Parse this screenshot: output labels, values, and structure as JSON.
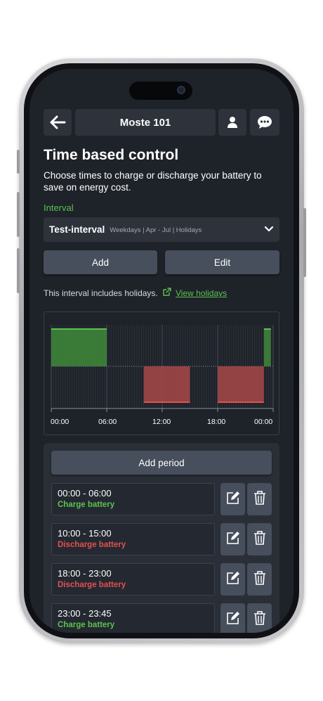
{
  "header": {
    "back_icon": "arrow-left-icon",
    "site_name": "Moste 101",
    "user_icon": "user-icon",
    "chat_icon": "chat-bubble-icon"
  },
  "page": {
    "title": "Time based control",
    "subtitle": "Choose times to charge or discharge your battery to save on energy cost."
  },
  "interval": {
    "label": "Interval",
    "selected_name": "Test-interval",
    "selected_desc": "Weekdays | Apr - Jul | Holidays",
    "add_label": "Add",
    "edit_label": "Edit",
    "holiday_text": "This interval includes holidays.",
    "holiday_link": "View holidays"
  },
  "colors": {
    "charge": "#5cc24f",
    "discharge": "#e05151",
    "background": "#1e2229",
    "button": "#474e5c"
  },
  "chart_data": {
    "type": "bar",
    "x_unit": "hours",
    "xlim": [
      0,
      24
    ],
    "x_ticks": [
      "00:00",
      "06:00",
      "12:00",
      "18:00",
      "00:00"
    ],
    "series": [
      {
        "name": "Charge battery",
        "direction": "up",
        "ranges": [
          [
            0,
            6
          ],
          [
            23,
            23.75
          ]
        ]
      },
      {
        "name": "Discharge battery",
        "direction": "down",
        "ranges": [
          [
            10,
            15
          ],
          [
            18,
            23
          ]
        ]
      }
    ]
  },
  "periods": {
    "add_label": "Add period",
    "items": [
      {
        "time": "00:00 - 06:00",
        "action": "Charge battery",
        "kind": "charge"
      },
      {
        "time": "10:00 - 15:00",
        "action": "Discharge battery",
        "kind": "discharge"
      },
      {
        "time": "18:00 - 23:00",
        "action": "Discharge battery",
        "kind": "discharge"
      },
      {
        "time": "23:00 - 23:45",
        "action": "Charge battery",
        "kind": "charge"
      }
    ],
    "edit_icon": "edit-icon",
    "delete_icon": "trash-icon"
  }
}
